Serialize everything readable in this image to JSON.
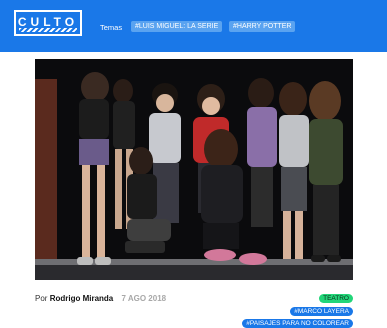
{
  "header": {
    "logo_text": "CULTO",
    "nav": {
      "temas": "Temas",
      "tag1": "#LUIS MIGUEL: LA SERIE",
      "tag2": "#HARRY POTTER"
    }
  },
  "article": {
    "byline_prefix": "Por",
    "author": "Rodrigo Miranda",
    "date": "7 AGO 2018",
    "tags": {
      "category": "TEATRO",
      "tag1": "#MARCO LAYERA",
      "tag2": "#PAISAJES PARA NO COLOREAR"
    }
  },
  "colors": {
    "brand_blue": "#1a78e8",
    "category_green": "#22d679"
  }
}
